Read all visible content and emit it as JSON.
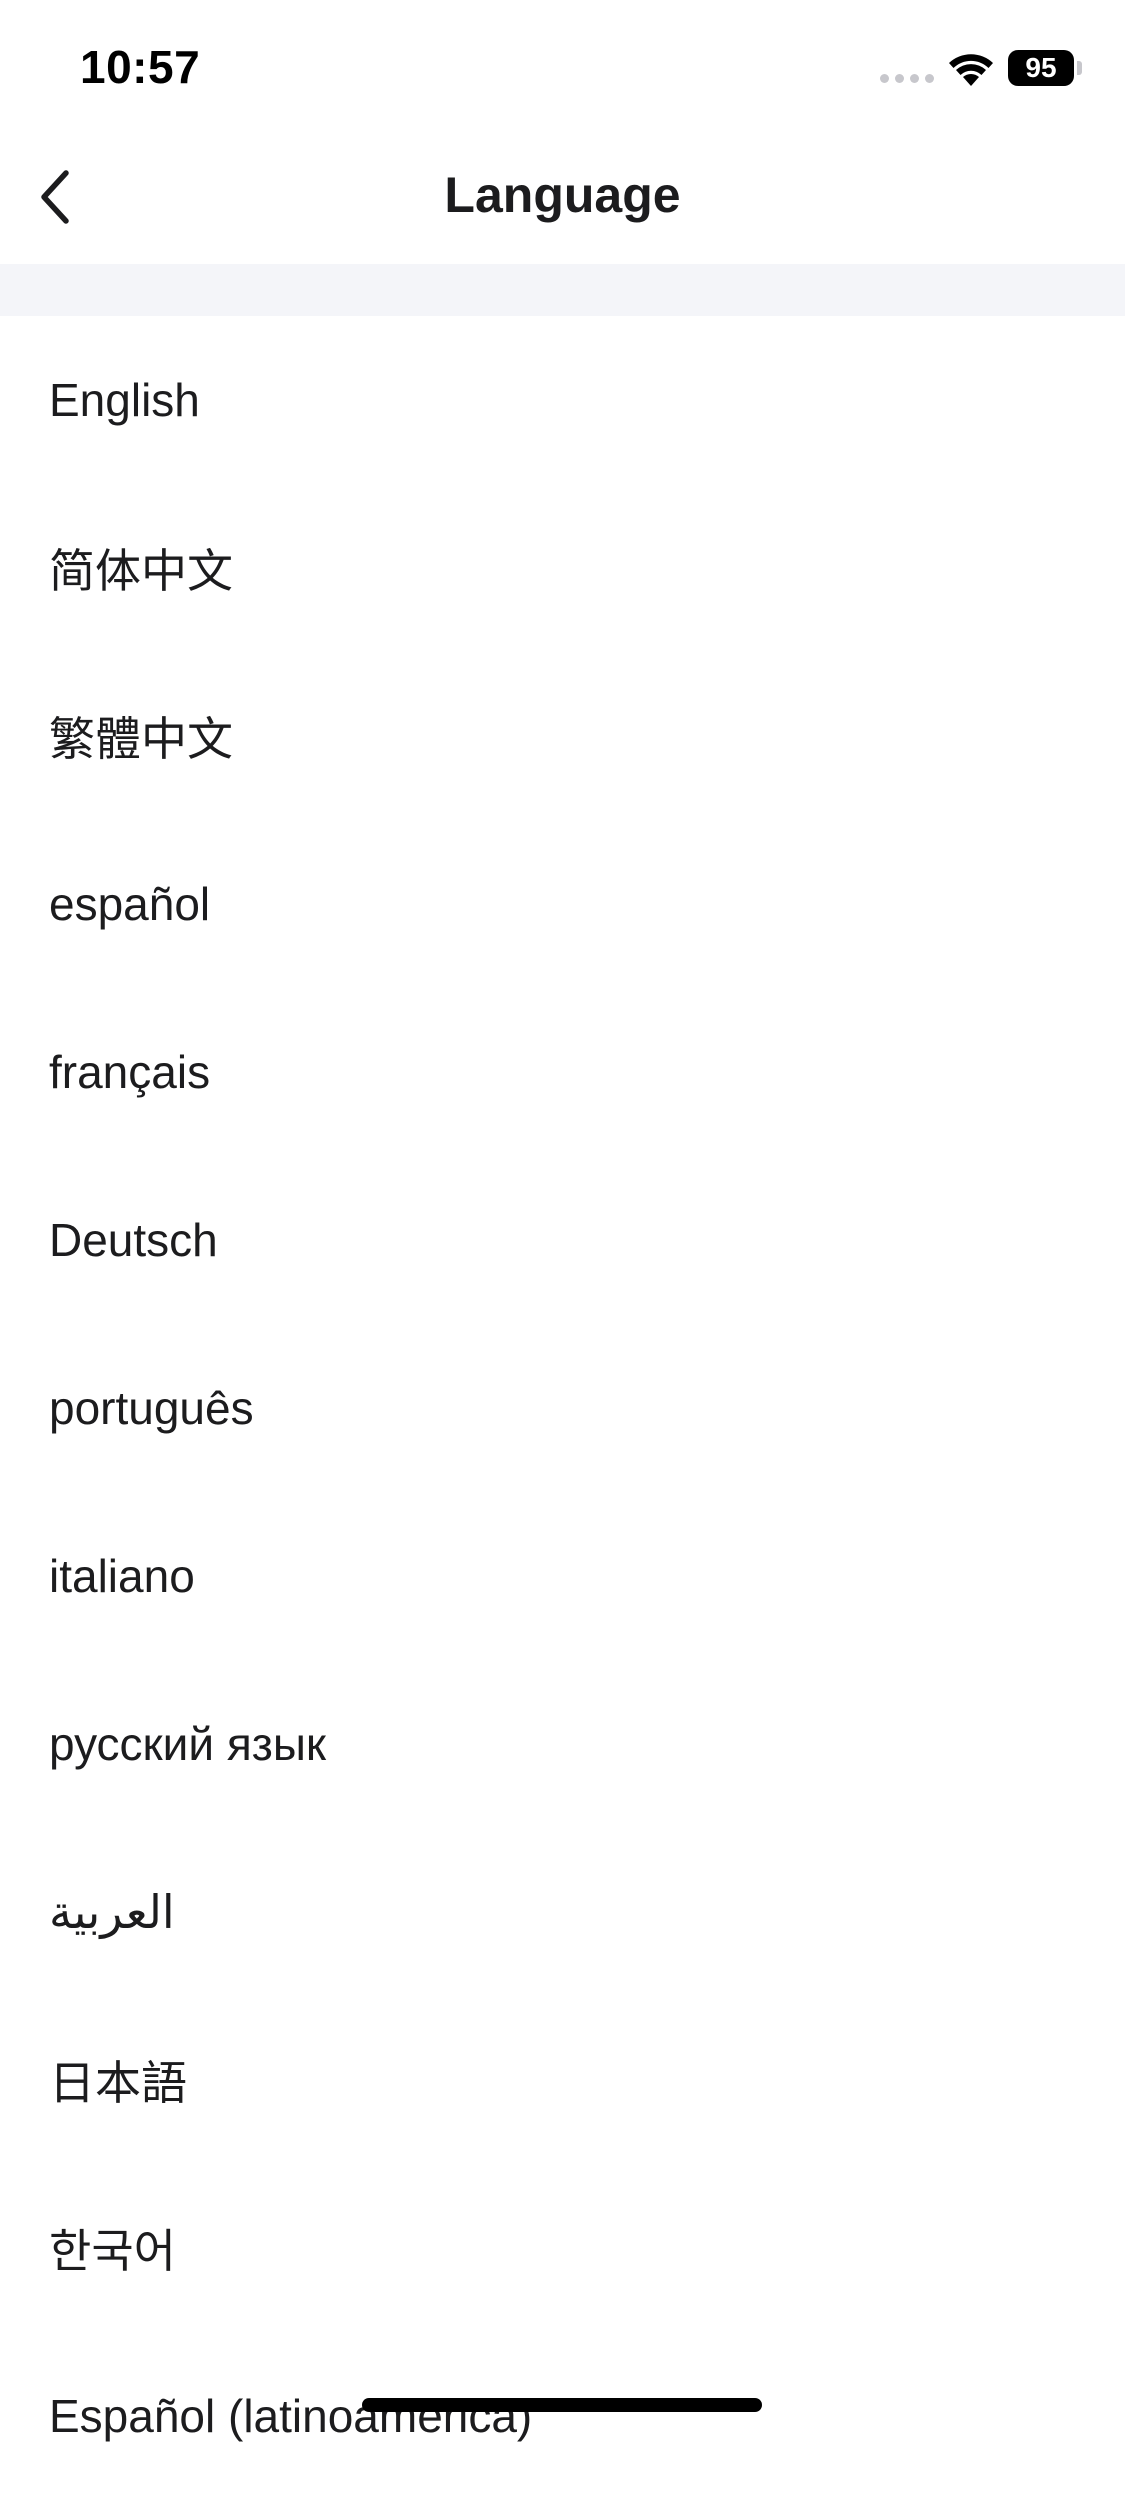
{
  "status_bar": {
    "time": "10:57",
    "battery": "95"
  },
  "nav": {
    "title": "Language",
    "back_icon": "chevron-left-icon"
  },
  "languages": [
    {
      "label": "English"
    },
    {
      "label": "简体中文"
    },
    {
      "label": "繁體中文"
    },
    {
      "label": "español"
    },
    {
      "label": "français"
    },
    {
      "label": "Deutsch"
    },
    {
      "label": "português"
    },
    {
      "label": "italiano"
    },
    {
      "label": "русский язык"
    },
    {
      "label": "العربية"
    },
    {
      "label": "日本語"
    },
    {
      "label": "한국어"
    },
    {
      "label": "Español (latinoamerica)"
    }
  ],
  "colors": {
    "background": "#ffffff",
    "band": "#f4f5f9",
    "text": "#1c1c1e"
  }
}
